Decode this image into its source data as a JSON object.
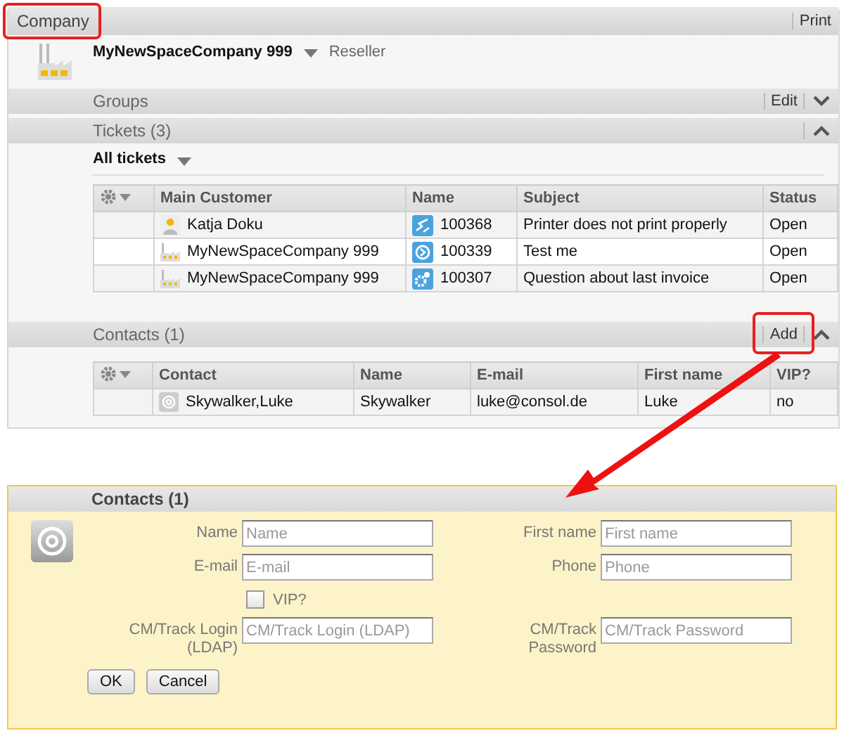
{
  "header": {
    "title": "Company",
    "print": "Print"
  },
  "company": {
    "name": "MyNewSpaceCompany 999",
    "type": "Reseller"
  },
  "groups": {
    "title": "Groups",
    "action": "Edit",
    "expanded": false
  },
  "tickets": {
    "title": "Tickets (3)",
    "expanded": true,
    "filter": "All tickets",
    "columns": [
      "Main Customer",
      "Name",
      "Subject",
      "Status"
    ],
    "rows": [
      {
        "customer": {
          "text": "Katja Doku",
          "kind": "person"
        },
        "ticket": {
          "number": "100368",
          "kind": "arrows"
        },
        "subject": "Printer does not print properly",
        "status": "Open"
      },
      {
        "customer": {
          "text": "MyNewSpaceCompany 999",
          "kind": "company"
        },
        "ticket": {
          "number": "100339",
          "kind": "ring"
        },
        "subject": "Test me",
        "status": "Open"
      },
      {
        "customer": {
          "text": "MyNewSpaceCompany 999",
          "kind": "company"
        },
        "ticket": {
          "number": "100307",
          "kind": "gear"
        },
        "subject": "Question about last invoice",
        "status": "Open"
      }
    ]
  },
  "contacts": {
    "title": "Contacts (1)",
    "action": "Add",
    "expanded": true,
    "columns": [
      "Contact",
      "Name",
      "E-mail",
      "First name",
      "VIP?"
    ],
    "rows": [
      {
        "contact": "Skywalker,Luke",
        "name": "Skywalker",
        "email": "luke@consol.de",
        "first_name": "Luke",
        "vip": "no"
      }
    ]
  },
  "form": {
    "title": "Contacts (1)",
    "rows": [
      {
        "left": {
          "kind": "text",
          "label": "Name",
          "placeholder": "Name"
        },
        "right": {
          "kind": "text",
          "label": "First name",
          "placeholder": "First name"
        }
      },
      {
        "left": {
          "kind": "text",
          "label": "E-mail",
          "placeholder": "E-mail"
        },
        "right": {
          "kind": "text",
          "label": "Phone",
          "placeholder": "Phone"
        }
      },
      {
        "left": {
          "kind": "checkbox",
          "label": "VIP?",
          "checked": false
        }
      },
      {
        "left": {
          "kind": "text",
          "label": "CM/Track Login (LDAP)",
          "placeholder": "CM/Track Login (LDAP)"
        },
        "right": {
          "kind": "text",
          "label": "CM/Track Password",
          "placeholder": "CM/Track Password"
        }
      }
    ],
    "buttons": [
      "OK",
      "Cancel"
    ]
  }
}
